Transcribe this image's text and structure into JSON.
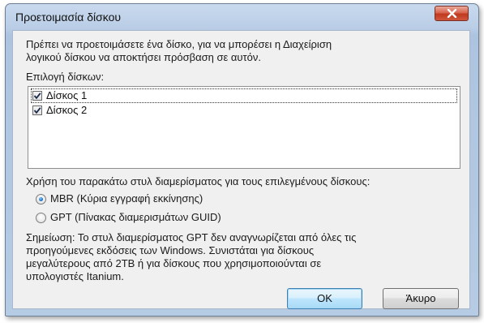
{
  "window": {
    "title": "Προετοιμασία δίσκου",
    "close_label": "Κλείσιμο"
  },
  "intro": {
    "line1": "Πρέπει να προετοιμάσετε ένα δίσκο, για να μπορέσει η Διαχείριση",
    "line2": "λογικού δίσκου να αποκτήσει πρόσβαση σε αυτόν."
  },
  "disks": {
    "label": "Επιλογή δίσκων:",
    "items": [
      {
        "label": "Δίσκος 1",
        "checked": true
      },
      {
        "label": "Δίσκος 2",
        "checked": true
      }
    ]
  },
  "partition_style": {
    "label": "Χρήση του παρακάτω στυλ διαμερίσματος για τους επιλεγμένους δίσκους:",
    "options": [
      {
        "label": "MBR (Κύρια εγγραφή εκκίνησης)",
        "selected": true
      },
      {
        "label": "GPT (Πίνακας διαμερισμάτων GUID)",
        "selected": false
      }
    ]
  },
  "note": {
    "line1": "Σημείωση: Το στυλ διαμερίσματος GPT δεν αναγνωρίζεται από όλες τις",
    "line2": "προηγούμενες εκδόσεις των Windows. Συνιστάται για δίσκους",
    "line3": "μεγαλύτερους από 2TB ή για δίσκους που χρησιμοποιούνται σε",
    "line4": "υπολογιστές Itanium."
  },
  "buttons": {
    "ok": "OK",
    "cancel": "Άκυρο"
  }
}
